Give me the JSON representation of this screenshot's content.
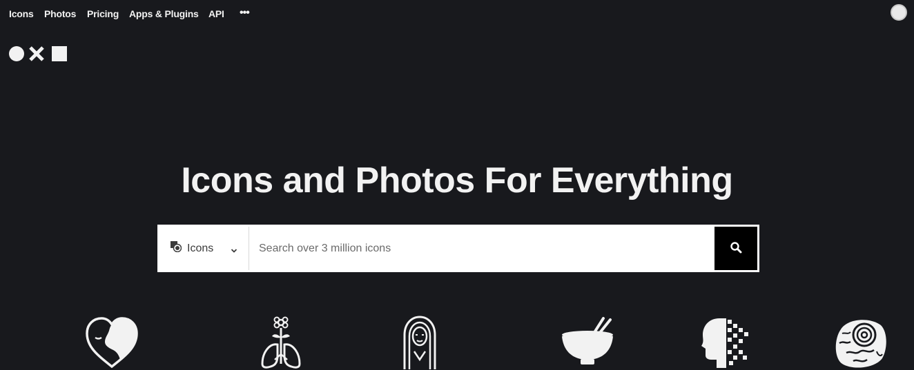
{
  "nav": {
    "items": [
      "Icons",
      "Photos",
      "Pricing",
      "Apps & Plugins",
      "API"
    ],
    "more_label": "•••",
    "avatar_icon": "user-avatar-icon"
  },
  "logo": {
    "shapes": [
      "circle",
      "cross",
      "square"
    ]
  },
  "hero": {
    "headline": "Icons and Photos For Everything"
  },
  "search": {
    "type_label": "Icons",
    "type_icon": "icons-category-icon",
    "placeholder": "Search over 3 million icons",
    "button_icon": "search-icon"
  },
  "featured_icons": [
    "heart-face-icon",
    "lungs-flower-icon",
    "woman-portrait-icon",
    "bowl-chopsticks-icon",
    "pixel-head-icon",
    "ammonite-fossil-icon"
  ],
  "colors": {
    "background": "#18191d",
    "text": "#f2f2f2",
    "search_button": "#000000"
  }
}
